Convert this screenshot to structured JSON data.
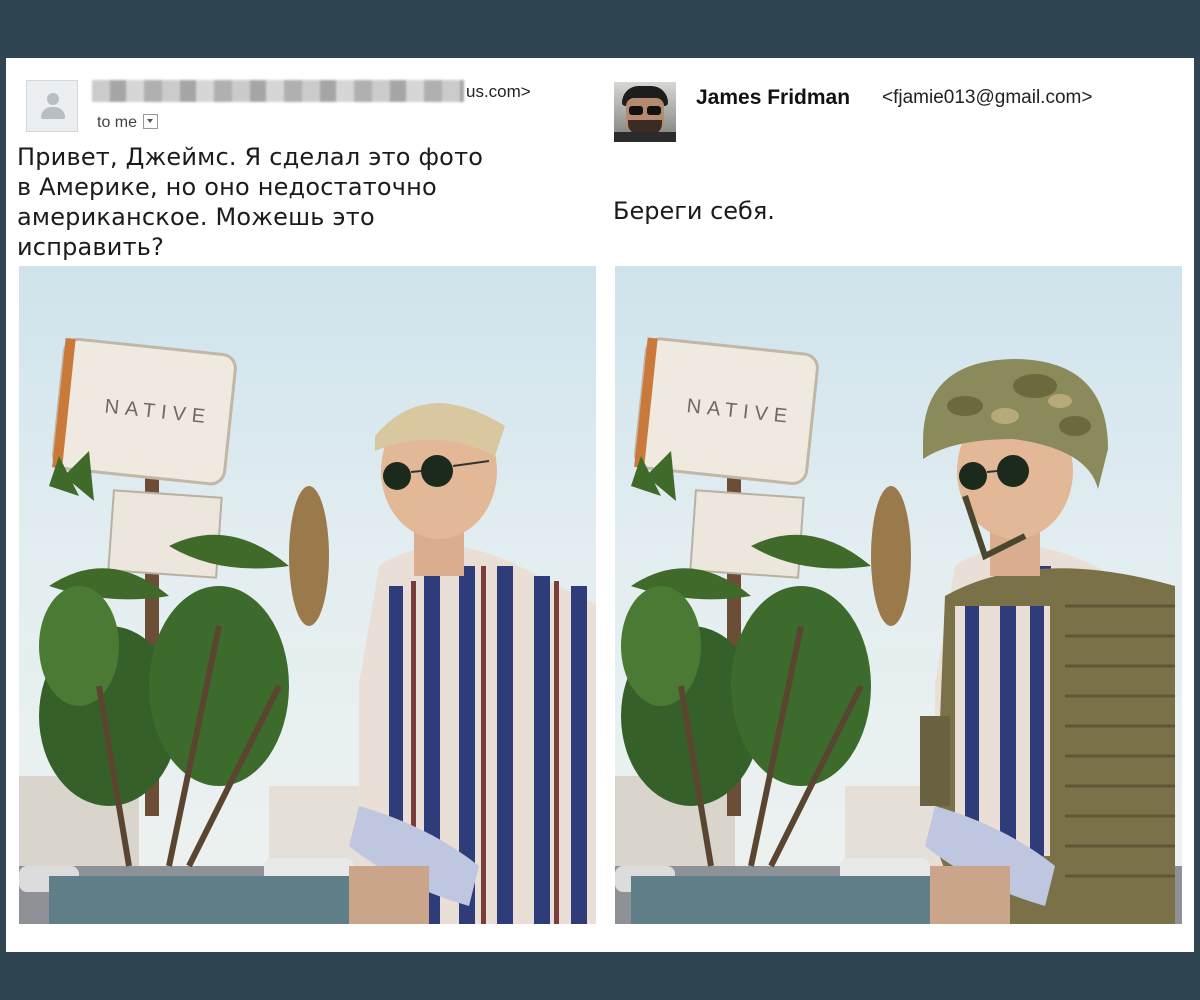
{
  "left_email": {
    "sender_visible_suffix": "us.com>",
    "recipient_label": "to me",
    "message": "Привет, Джеймс. Я сделал это фото\nв Америке, но оно недостаточно\nамериканское. Можешь это\nисправить?"
  },
  "right_email": {
    "sender_name": "James Fridman",
    "sender_email": "<fjamie013@gmail.com>",
    "message": "Береги себя."
  },
  "photos": {
    "sign_text": "NATIVE"
  },
  "icons": {
    "generic_avatar": "person-icon",
    "dropdown": "chevron-down-icon"
  },
  "colors": {
    "page_background": "#2f4551",
    "card_background": "#ffffff",
    "shirt_stripe_blue": "#2e3d7a",
    "helmet_camo": "#8a8a5a"
  }
}
